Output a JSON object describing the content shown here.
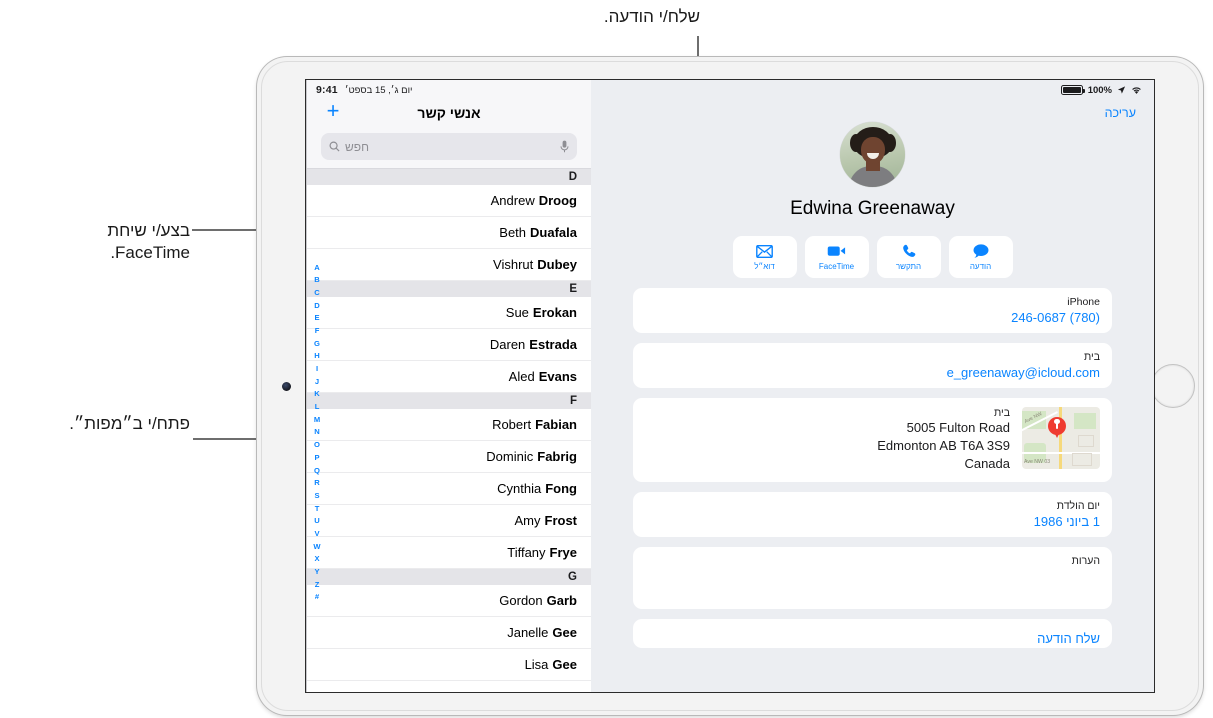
{
  "callouts": [
    {
      "id": "message",
      "text": "שלח/י הודעה."
    },
    {
      "id": "facetime",
      "text": "בצע/י שיחת\nFaceTime."
    },
    {
      "id": "maps",
      "text": "פתח/י ב״מפות״."
    }
  ],
  "statusbar": {
    "battery_percent": "100%",
    "time": "9:41",
    "date": "יום ג׳, 15 בספט׳",
    "location_icon": "location-arrow-icon",
    "wifi_icon": "wifi-icon",
    "battery_icon": "battery-icon"
  },
  "contacts_panel": {
    "title": "אנשי קשר",
    "add_label": "+",
    "search": {
      "placeholder": "חפש",
      "search_icon": "search-icon",
      "mic_icon": "microphone-icon"
    },
    "index_letters": [
      "A",
      "B",
      "C",
      "D",
      "E",
      "F",
      "G",
      "H",
      "I",
      "J",
      "K",
      "L",
      "M",
      "N",
      "O",
      "P",
      "Q",
      "R",
      "S",
      "T",
      "U",
      "V",
      "W",
      "X",
      "Y",
      "Z",
      "#"
    ],
    "sections": [
      {
        "letter": "D",
        "contacts": [
          {
            "first": "Andrew",
            "last": "Droog"
          },
          {
            "first": "Beth",
            "last": "Duafala"
          },
          {
            "first": "Vishrut",
            "last": "Dubey"
          }
        ]
      },
      {
        "letter": "E",
        "contacts": [
          {
            "first": "Sue",
            "last": "Erokan"
          },
          {
            "first": "Daren",
            "last": "Estrada"
          },
          {
            "first": "Aled",
            "last": "Evans"
          }
        ]
      },
      {
        "letter": "F",
        "contacts": [
          {
            "first": "Robert",
            "last": "Fabian"
          },
          {
            "first": "Dominic",
            "last": "Fabrig"
          },
          {
            "first": "Cynthia",
            "last": "Fong"
          },
          {
            "first": "Amy",
            "last": "Frost"
          },
          {
            "first": "Tiffany",
            "last": "Frye"
          }
        ]
      },
      {
        "letter": "G",
        "contacts": [
          {
            "first": "Gordon",
            "last": "Garb"
          },
          {
            "first": "Janelle",
            "last": "Gee"
          },
          {
            "first": "Lisa",
            "last": "Gee"
          }
        ]
      }
    ]
  },
  "detail": {
    "edit_label": "עריכה",
    "contact_name": "Edwina Greenaway",
    "avatar_name": "contact-avatar",
    "actions": [
      {
        "label": "דוא״ל",
        "icon": "mail-icon",
        "name": "mail-button"
      },
      {
        "label": "FaceTime",
        "icon": "video-icon",
        "name": "facetime-button"
      },
      {
        "label": "התקשר",
        "icon": "phone-icon",
        "name": "call-button"
      },
      {
        "label": "הודעה",
        "icon": "message-icon",
        "name": "message-button"
      }
    ],
    "phone": {
      "label": "iPhone",
      "value": "246-0687 (780)"
    },
    "email": {
      "label": "בית",
      "value": "e_greenaway@icloud.com"
    },
    "address": {
      "label": "בית",
      "lines": [
        "5005 Fulton Road",
        "Edmonton AB T6A 3S9",
        "Canada"
      ],
      "map_pin_icon": "map-pin-icon",
      "map_labels": [
        "Ave NW",
        "03 Ave NW"
      ]
    },
    "birthday": {
      "label": "יום הולדת",
      "value": "1 ביוני 1986"
    },
    "notes": {
      "label": "הערות",
      "value": ""
    },
    "send_message": {
      "label": "שלח הודעה"
    }
  },
  "colors": {
    "accent": "#0a84ff",
    "pin": "#ef3b30",
    "screen_bg": "#eceef2"
  }
}
